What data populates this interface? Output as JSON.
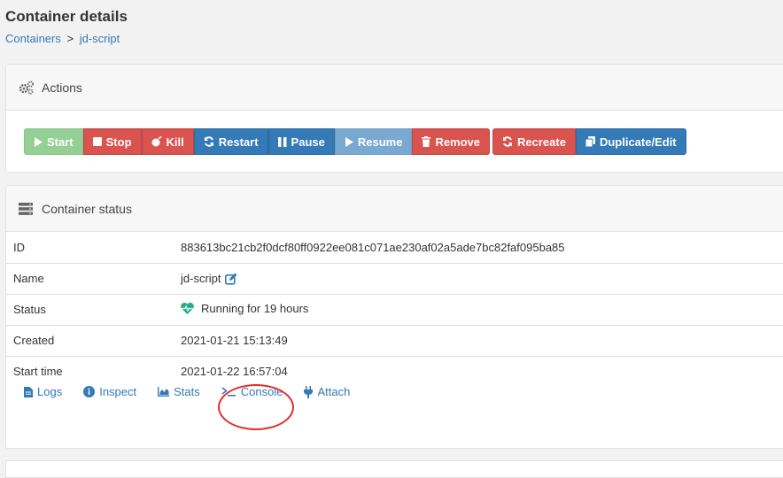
{
  "header": {
    "title": "Container details",
    "breadcrumb": {
      "root": "Containers",
      "separator": ">",
      "current": "jd-script"
    }
  },
  "actions": {
    "title": "Actions",
    "icon": "cogs-icon",
    "buttons": {
      "start": "Start",
      "stop": "Stop",
      "kill": "Kill",
      "restart": "Restart",
      "pause": "Pause",
      "resume": "Resume",
      "remove": "Remove",
      "recreate": "Recreate",
      "duplicate": "Duplicate/Edit"
    }
  },
  "status": {
    "title": "Container status",
    "icon": "server-icon",
    "rows": [
      {
        "key": "ID",
        "value": "883613bc21cb2f0dcf80ff0922ee081c071ae230af02a5ade7bc82faf095ba85"
      },
      {
        "key": "Name",
        "value": "jd-script"
      },
      {
        "key": "Status",
        "value": "Running for 19 hours"
      },
      {
        "key": "Created",
        "value": "2021-01-21 15:13:49"
      },
      {
        "key": "Start time",
        "value": "2021-01-22 16:57:04"
      }
    ],
    "links": {
      "logs": "Logs",
      "inspect": "Inspect",
      "stats": "Stats",
      "console": "Console",
      "attach": "Attach"
    }
  },
  "colors": {
    "primary": "#337ab7",
    "success": "#5cb85c",
    "danger": "#d9534f",
    "running": "#23ae89",
    "annotation": "#e03030"
  }
}
